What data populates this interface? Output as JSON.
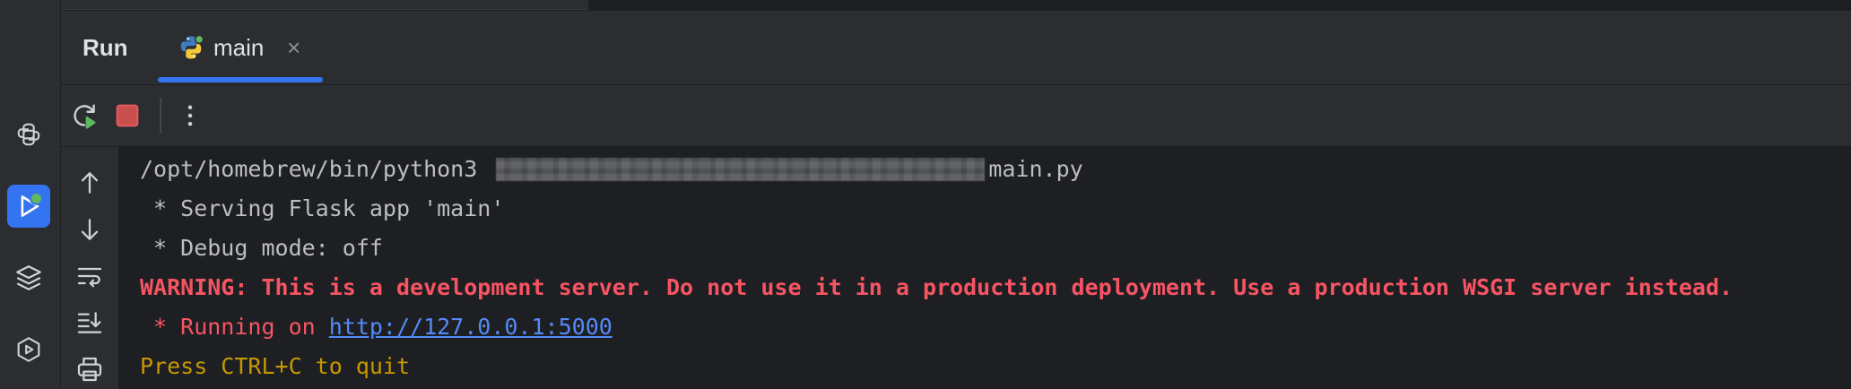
{
  "window": {
    "panel_title": "Run"
  },
  "tab": {
    "label": "main",
    "close": "×"
  },
  "left_bar": {
    "items": [
      {
        "name": "python-console",
        "icon": "python-icon"
      },
      {
        "name": "run",
        "icon": "run-icon",
        "active": true
      },
      {
        "name": "services",
        "icon": "layers-icon"
      },
      {
        "name": "services-run",
        "icon": "services-icon"
      }
    ]
  },
  "toolbar": {
    "rerun": "rerun-icon",
    "stop": "stop-icon",
    "more": "more-icon"
  },
  "console": {
    "cmd_prefix": "/opt/homebrew/bin/python3 ",
    "cmd_suffix": "main.py",
    "serving": " * Serving Flask app 'main'",
    "debug": " * Debug mode: off",
    "warning": "WARNING: This is a development server. Do not use it in a production deployment. Use a production WSGI server instead.",
    "running_prefix": " * Running on ",
    "url": "http://127.0.0.1:5000",
    "quit": "Press CTRL+C to quit"
  },
  "colors": {
    "accent": "#3574f0",
    "error": "#f75464",
    "link": "#548af7",
    "warning_text": "#c69800",
    "console_bg": "#1e1f22"
  }
}
